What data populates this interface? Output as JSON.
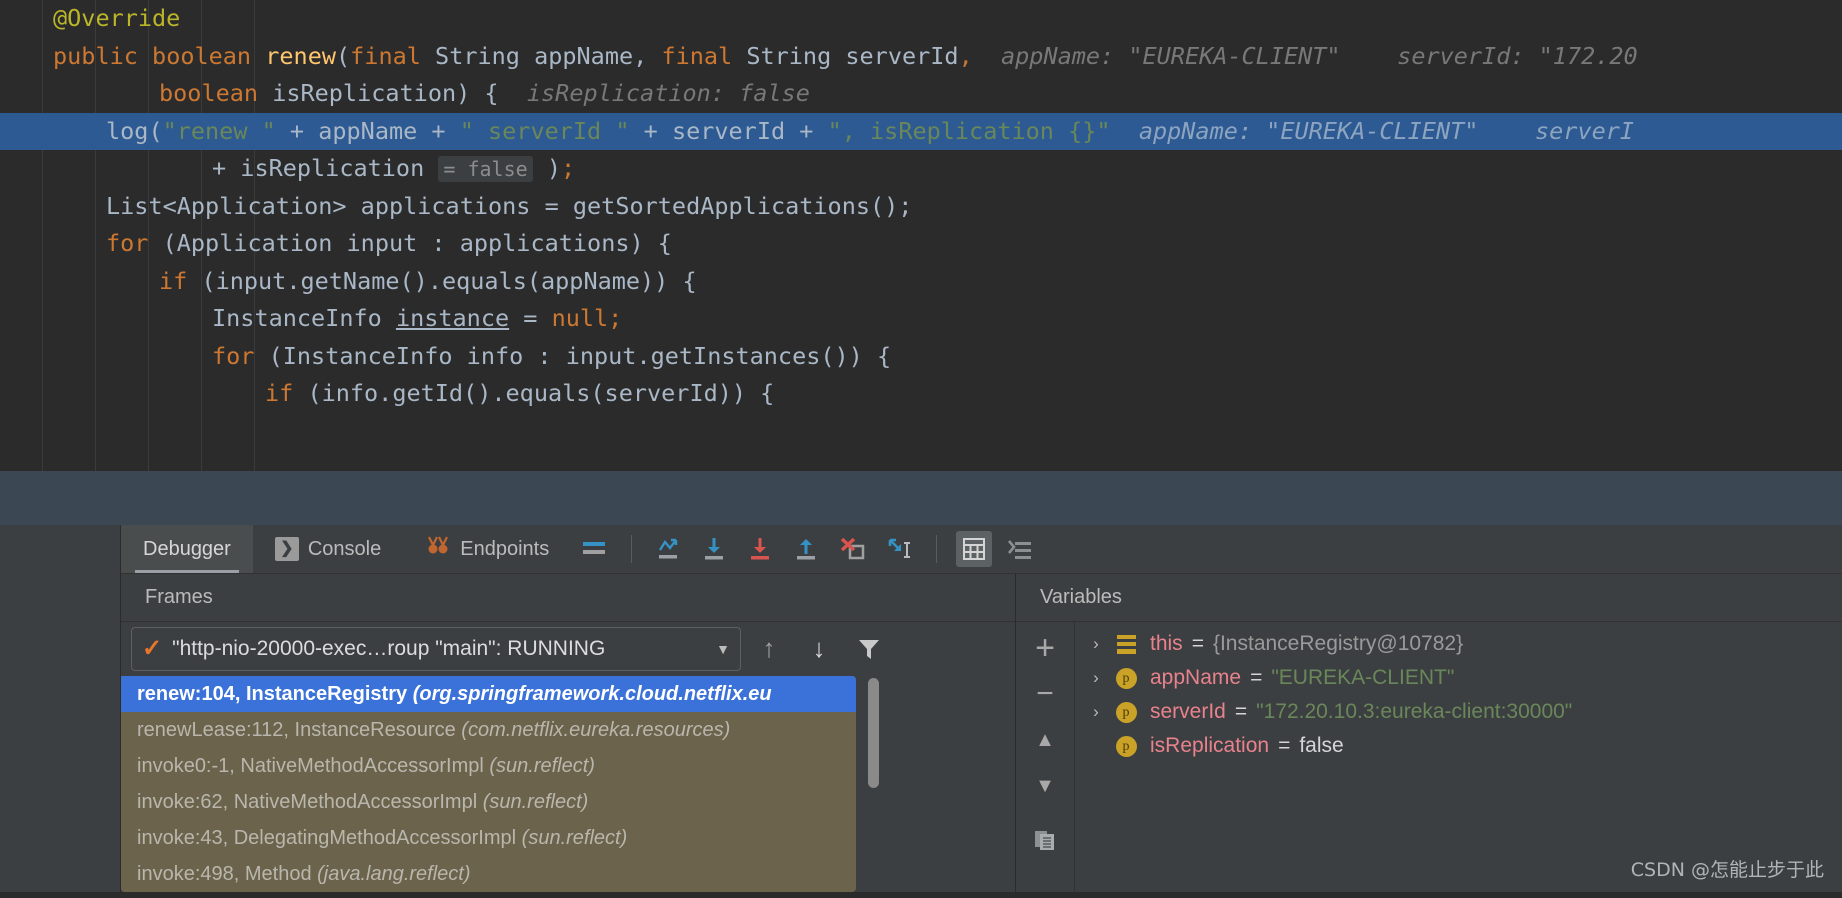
{
  "editor": {
    "lines": [
      {
        "id": "line-override",
        "indent": 1,
        "segments": [
          {
            "t": "@Override",
            "c": "anno"
          }
        ],
        "hints": []
      },
      {
        "id": "line-signature",
        "indent": 1,
        "segments": [
          {
            "t": "public",
            "c": "kw"
          },
          {
            "t": " ",
            "c": "ident"
          },
          {
            "t": "boolean",
            "c": "kw"
          },
          {
            "t": " ",
            "c": "ident"
          },
          {
            "t": "renew",
            "c": "meth"
          },
          {
            "t": "(",
            "c": "ident"
          },
          {
            "t": "final",
            "c": "kw"
          },
          {
            "t": " String appName, ",
            "c": "ident"
          },
          {
            "t": "final",
            "c": "kw"
          },
          {
            "t": " String serverId",
            "c": "ident"
          },
          {
            "t": ",",
            "c": "kw"
          }
        ],
        "hints": [
          "appName: \"EUREKA-CLIENT\"",
          "serverId: \"172.20"
        ]
      },
      {
        "id": "line-isreplication-param",
        "indent": 3,
        "segments": [
          {
            "t": "boolean",
            "c": "kw"
          },
          {
            "t": " isReplication) {",
            "c": "ident"
          }
        ],
        "hints": [
          "isReplication: false"
        ]
      },
      {
        "id": "line-log",
        "indent": 2,
        "highlight": true,
        "segments": [
          {
            "t": "log(",
            "c": "ident"
          },
          {
            "t": "\"renew \"",
            "c": "str"
          },
          {
            "t": " + appName + ",
            "c": "ident"
          },
          {
            "t": "\" serverId \"",
            "c": "str"
          },
          {
            "t": " + serverId + ",
            "c": "ident"
          },
          {
            "t": "\", isReplication {}\"",
            "c": "str"
          }
        ],
        "hints": [
          "appName: \"EUREKA-CLIENT\"",
          "serverI"
        ]
      },
      {
        "id": "line-log-cont",
        "indent": 4,
        "segments": [
          {
            "t": "+ isReplication ",
            "c": "ident"
          },
          {
            "t": "= false",
            "c": "inlay"
          },
          {
            "t": " )",
            "c": "ident"
          },
          {
            "t": ";",
            "c": "kw"
          }
        ],
        "hints": []
      },
      {
        "id": "line-applications",
        "indent": 2,
        "segments": [
          {
            "t": "List<Application> applications = getSortedApplications();",
            "c": "ident"
          }
        ],
        "hints": []
      },
      {
        "id": "line-for-application",
        "indent": 2,
        "segments": [
          {
            "t": "for",
            "c": "kw"
          },
          {
            "t": " (Application input : applications) {",
            "c": "ident"
          }
        ],
        "hints": []
      },
      {
        "id": "line-if-getname",
        "indent": 3,
        "segments": [
          {
            "t": "if",
            "c": "kw"
          },
          {
            "t": " (input.getName().equals(appName)) {",
            "c": "ident"
          }
        ],
        "hints": []
      },
      {
        "id": "line-instance-null",
        "indent": 4,
        "segments": [
          {
            "t": "InstanceInfo ",
            "c": "ident"
          },
          {
            "t": "instance",
            "c": "under"
          },
          {
            "t": " = ",
            "c": "ident"
          },
          {
            "t": "null",
            "c": "kw"
          },
          {
            "t": ";",
            "c": "kw"
          }
        ],
        "hints": []
      },
      {
        "id": "line-for-instanceinfo",
        "indent": 4,
        "segments": [
          {
            "t": "for",
            "c": "kw"
          },
          {
            "t": " (InstanceInfo info : input.getInstances()) {",
            "c": "ident"
          }
        ],
        "hints": []
      },
      {
        "id": "line-if-getid",
        "indent": 5,
        "segments": [
          {
            "t": "if",
            "c": "kw"
          },
          {
            "t": " (info.getId().equals(serverId)) {",
            "c": "ident"
          }
        ],
        "hints": []
      }
    ]
  },
  "panel": {
    "tabs": [
      {
        "id": "tab-debugger",
        "label": "Debugger",
        "icon": "",
        "active": true
      },
      {
        "id": "tab-console",
        "label": "Console",
        "icon": "console-icon",
        "active": false
      },
      {
        "id": "tab-endpoints",
        "label": "Endpoints",
        "icon": "endpoints-icon",
        "active": false
      }
    ],
    "toolbar_icons": [
      {
        "id": "layout-icon",
        "name": "layout-settings-icon"
      },
      {
        "id": "step-over-icon",
        "name": "step-over-icon"
      },
      {
        "id": "step-into-icon",
        "name": "step-into-icon"
      },
      {
        "id": "force-step-into-icon",
        "name": "force-step-into-icon"
      },
      {
        "id": "step-out-icon",
        "name": "step-out-icon"
      },
      {
        "id": "drop-frame-icon",
        "name": "drop-frame-icon"
      },
      {
        "id": "run-to-cursor-icon",
        "name": "run-to-cursor-icon"
      },
      {
        "id": "evaluate-icon",
        "name": "evaluate-expression-icon"
      },
      {
        "id": "settings-icon",
        "name": "debugger-settings-icon"
      }
    ],
    "frames": {
      "header": "Frames",
      "thread": "\"http-nio-20000-exec…roup \"main\": RUNNING",
      "stack": [
        {
          "id": "frame-renew",
          "main": "renew:104, InstanceRegistry ",
          "pkg": "(org.springframework.cloud.netflix.eu",
          "selected": true
        },
        {
          "id": "frame-renewlease",
          "main": "renewLease:112, InstanceResource ",
          "pkg": "(com.netflix.eureka.resources)",
          "selected": false
        },
        {
          "id": "frame-invoke0",
          "main": "invoke0:-1, NativeMethodAccessorImpl ",
          "pkg": "(sun.reflect)",
          "selected": false
        },
        {
          "id": "frame-invoke62",
          "main": "invoke:62, NativeMethodAccessorImpl ",
          "pkg": "(sun.reflect)",
          "selected": false
        },
        {
          "id": "frame-invoke43",
          "main": "invoke:43, DelegatingMethodAccessorImpl ",
          "pkg": "(sun.reflect)",
          "selected": false
        },
        {
          "id": "frame-invoke-more",
          "main": "invoke:498, Method ",
          "pkg": "(java.lang.reflect)",
          "selected": false
        }
      ]
    },
    "variables": {
      "header": "Variables",
      "rows": [
        {
          "id": "var-this",
          "arrow": "›",
          "icon": "field-icon",
          "name": "this",
          "eq": "=",
          "value": "{InstanceRegistry@10782}",
          "vtype": "obj"
        },
        {
          "id": "var-appname",
          "arrow": "›",
          "icon": "param-icon",
          "name": "appName",
          "eq": "=",
          "value": "\"EUREKA-CLIENT\"",
          "vtype": "str"
        },
        {
          "id": "var-serverid",
          "arrow": "›",
          "icon": "param-icon",
          "name": "serverId",
          "eq": "=",
          "value": "\"172.20.10.3:eureka-client:30000\"",
          "vtype": "str"
        },
        {
          "id": "var-isreplication",
          "arrow": "",
          "icon": "param-icon",
          "name": "isReplication",
          "eq": "=",
          "value": "false",
          "vtype": "bool"
        }
      ],
      "rail": [
        {
          "id": "rail-add",
          "glyph": "+",
          "name": "add-watch-button"
        },
        {
          "id": "rail-remove",
          "glyph": "−",
          "name": "remove-watch-button"
        },
        {
          "id": "rail-up",
          "glyph": "▲",
          "name": "move-up-button"
        },
        {
          "id": "rail-down",
          "glyph": "▼",
          "name": "move-down-button"
        },
        {
          "id": "rail-copy",
          "glyph": "▤",
          "name": "copy-value-button"
        }
      ]
    }
  },
  "watermark": "CSDN @怎能止步于此",
  "colors": {
    "editor_bg": "#2b2b2b",
    "highlight_line": "#2d5a92",
    "panel_bg": "#3c3f41",
    "selection_blue": "#3b72d9",
    "frames_olive": "#6b634b",
    "band": "#3c4754",
    "keyword": "#cc7832",
    "string": "#6a8759",
    "annotation": "#bbb529",
    "method": "#ffc66d",
    "var_name": "#e8828c",
    "param_icon": "#c9a227"
  }
}
